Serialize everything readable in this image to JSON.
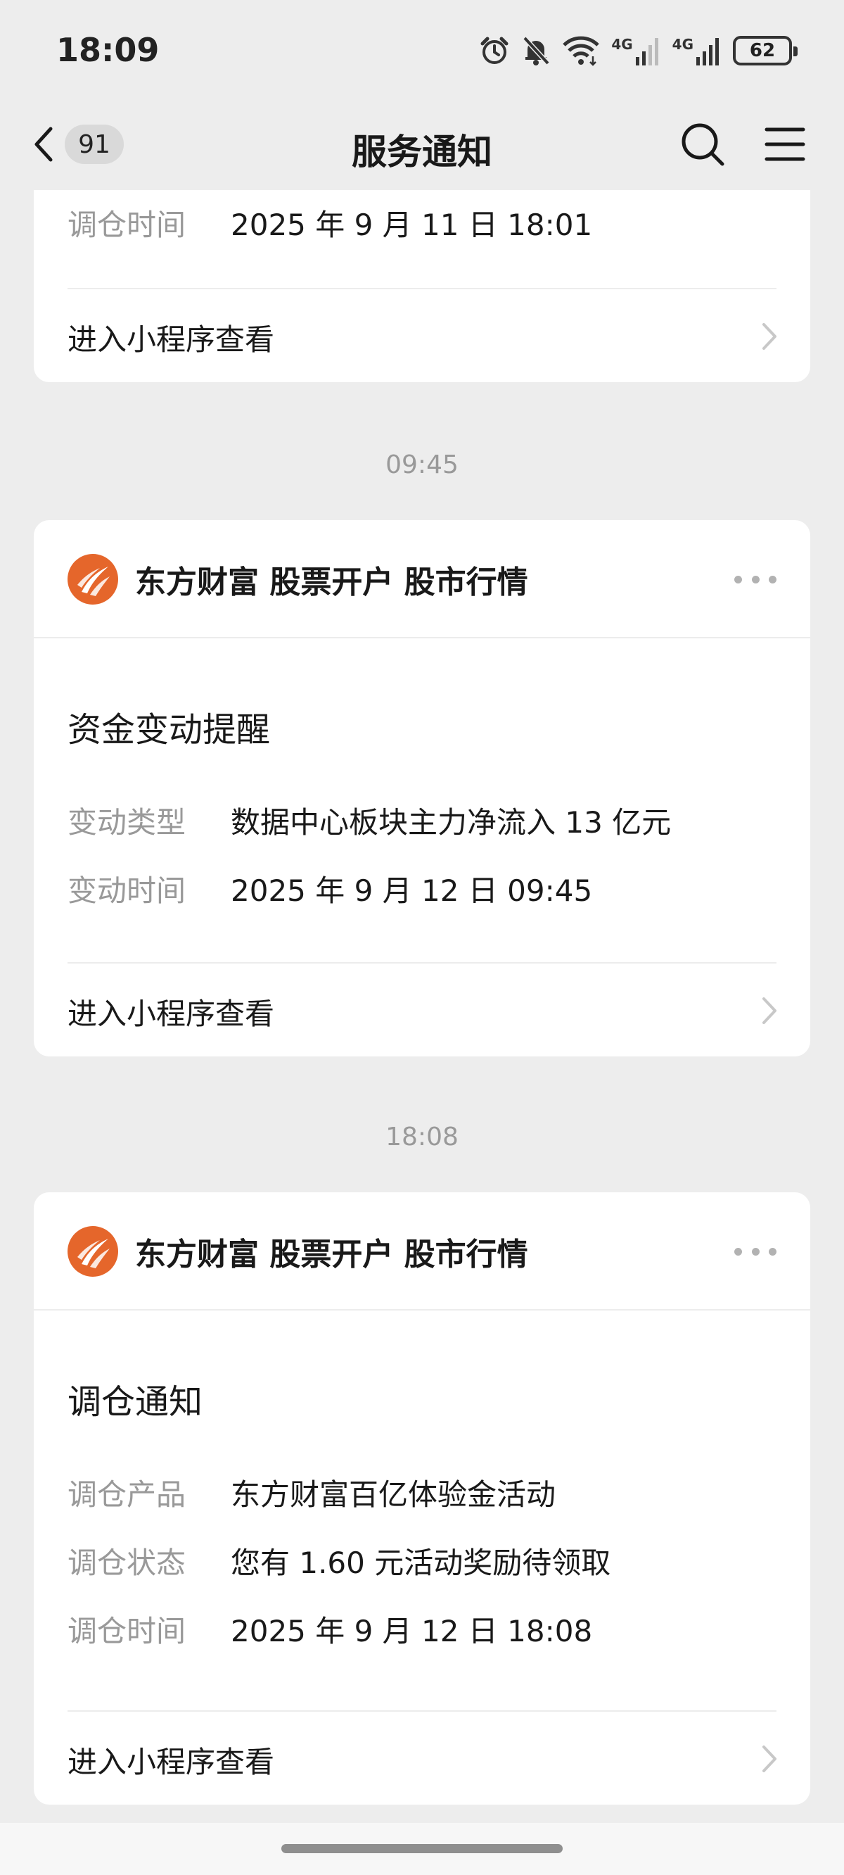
{
  "status_bar": {
    "time": "18:09",
    "icons": [
      "alarm-icon",
      "mute-bell-icon",
      "wifi-icon",
      "signal-4g-icon",
      "signal-4g-icon"
    ],
    "network_label_1": "4G",
    "network_label_2": "4G",
    "battery": "62"
  },
  "nav": {
    "unread_count": "91",
    "title": "服务通知",
    "icons": [
      "back-chevron-icon",
      "search-icon",
      "menu-icon"
    ]
  },
  "cards": [
    {
      "partial": true,
      "rows": [
        {
          "label": "调仓时间",
          "value": "2025 年 9 月 11 日 18:01"
        }
      ],
      "link_label": "进入小程序查看"
    },
    {
      "timestamp": "09:45",
      "brand": "东方财富 股票开户 股市行情",
      "title": "资金变动提醒",
      "rows": [
        {
          "label": "变动类型",
          "value": "数据中心板块主力净流入 13 亿元"
        },
        {
          "label": "变动时间",
          "value": "2025 年 9 月 12 日 09:45"
        }
      ],
      "link_label": "进入小程序查看"
    },
    {
      "timestamp": "18:08",
      "brand": "东方财富 股票开户 股市行情",
      "title": "调仓通知",
      "rows": [
        {
          "label": "调仓产品",
          "value": "东方财富百亿体验金活动"
        },
        {
          "label": "调仓状态",
          "value": "您有 1.60 元活动奖励待领取"
        },
        {
          "label": "调仓时间",
          "value": "2025 年 9 月 12 日 18:08"
        }
      ],
      "link_label": "进入小程序查看"
    }
  ],
  "colors": {
    "background": "#ededed",
    "card": "#ffffff",
    "secondary_text": "#999999",
    "brand_orange": "#e5662b"
  }
}
